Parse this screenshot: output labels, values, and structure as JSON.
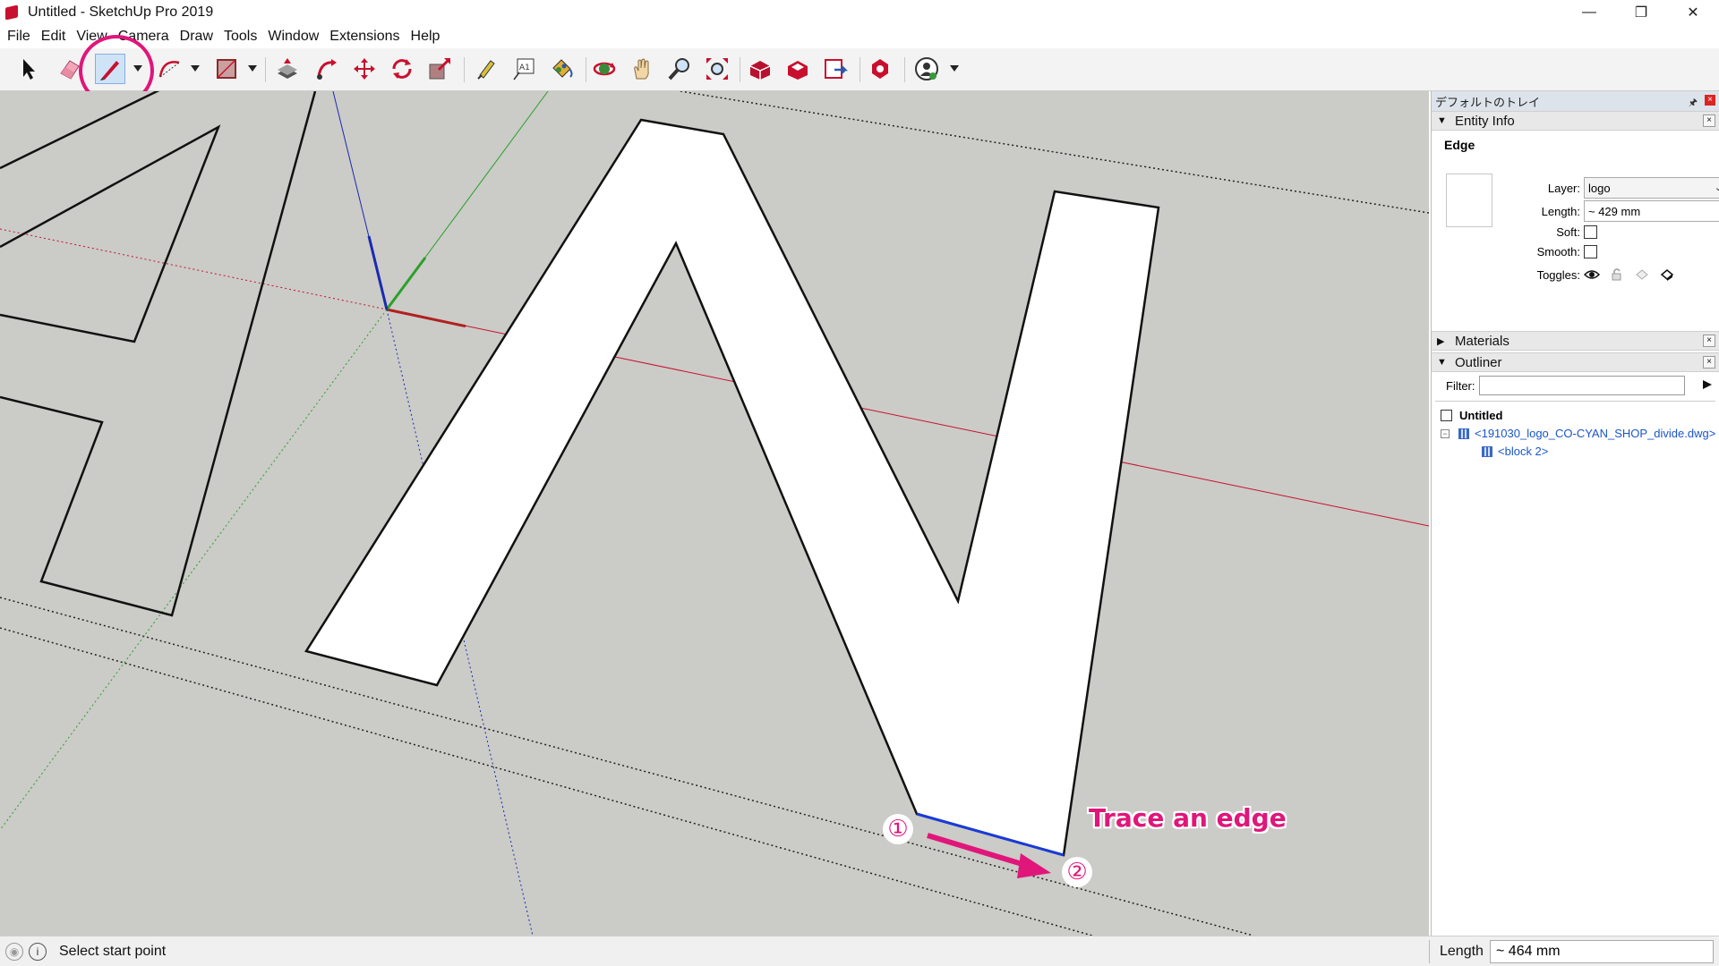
{
  "window": {
    "title": "Untitled - SketchUp Pro 2019",
    "minimize": "—",
    "maximize": "❐",
    "close": "✕"
  },
  "menu": [
    "File",
    "Edit",
    "View",
    "Camera",
    "Draw",
    "Tools",
    "Window",
    "Extensions",
    "Help"
  ],
  "toolbar": {
    "tools": [
      "select",
      "eraser",
      "line",
      "arc",
      "rectangle",
      "push-pull",
      "follow-me",
      "move",
      "rotate",
      "scale",
      "tape-measure",
      "text",
      "paint-bucket",
      "orbit",
      "pan",
      "zoom",
      "zoom-extents",
      "3d-warehouse",
      "extension-warehouse",
      "layout",
      "extension-manager",
      "profile"
    ],
    "active_tool": "line",
    "highlight_color": "#e0167a"
  },
  "viewport": {
    "background": "#cbcbc7",
    "annotation": {
      "label": "Trace an edge",
      "step1": "①",
      "step2": "②",
      "color": "#e0167a"
    }
  },
  "tray": {
    "title": "デフォルトのトレイ",
    "pin": "🖈",
    "close": "×",
    "entity_info": {
      "header": "Entity Info",
      "type": "Edge",
      "layer_label": "Layer:",
      "layer_value": "logo",
      "length_label": "Length:",
      "length_value": "~ 429 mm",
      "soft_label": "Soft:",
      "soft_checked": false,
      "smooth_label": "Smooth:",
      "smooth_checked": false,
      "toggles_label": "Toggles:"
    },
    "materials": {
      "header": "Materials"
    },
    "outliner": {
      "header": "Outliner",
      "filter_label": "Filter:",
      "filter_value": "",
      "root": "Untitled",
      "items": [
        {
          "label": "<191030_logo_CO-CYAN_SHOP_divide.dwg>"
        },
        {
          "label": "<block 2>"
        }
      ]
    },
    "close_icon": "×",
    "collapsed_tri": "▶",
    "expanded_tri": "▼"
  },
  "status": {
    "message": "Select start point",
    "measurement_label": "Length",
    "measurement_value": "~ 464 mm"
  }
}
